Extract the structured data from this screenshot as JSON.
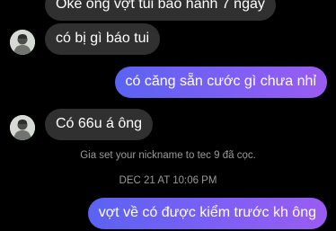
{
  "contact": {
    "avatar_icon": "person-avatar-icon"
  },
  "messages": [
    {
      "id": "m1",
      "direction": "incoming",
      "text": "Oke ông vợt tui bảo hành 7 ngày"
    },
    {
      "id": "m2",
      "direction": "incoming",
      "text": "có bị gì báo tui"
    },
    {
      "id": "m3",
      "direction": "outgoing",
      "text": "có căng sẵn cước gì chưa nhỉ"
    },
    {
      "id": "m4",
      "direction": "incoming",
      "text": "Có 66u á ông"
    },
    {
      "id": "m5",
      "direction": "outgoing",
      "text": "vợt về có được kiểm trước kh ông"
    }
  ],
  "system_notice": "Gia set your nickname to tec 9 đã cọc.",
  "timestamp": "DEC 21 AT 10:06 PM",
  "colors": {
    "background": "#000000",
    "incoming_bubble": "#303030",
    "outgoing_gradient_start": "#5a63f2",
    "outgoing_gradient_end": "#9a5cf2",
    "meta_text": "#9a9a9a"
  }
}
